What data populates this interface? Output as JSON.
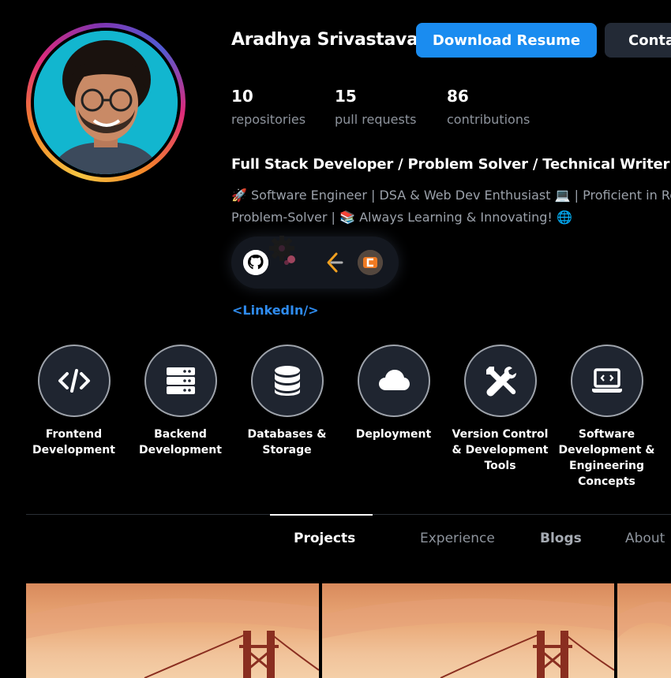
{
  "profile": {
    "name": "Aradhya Srivastava",
    "download_resume": "Download Resume",
    "contact": "Conta",
    "headline": "Full Stack Developer / Problem Solver / Technical Writer",
    "bio_line1": "Software Engineer | DSA & Web Dev Enthusiast",
    "bio_line1_tail": "| Proficient in Rea",
    "bio_line2": "Problem-Solver |",
    "bio_line2_tail": "Always Learning & Innovating!",
    "linkedin": "<LinkedIn/>"
  },
  "stats": [
    {
      "value": "10",
      "label": "repositories"
    },
    {
      "value": "15",
      "label": "pull requests"
    },
    {
      "value": "86",
      "label": "contributions"
    }
  ],
  "social": [
    {
      "icon": "github-icon"
    },
    {
      "icon": "gear-icon"
    },
    {
      "icon": "leetcode-icon"
    },
    {
      "icon": "codechef-icon"
    }
  ],
  "skills": [
    {
      "label": "Frontend Development",
      "icon": "code-icon"
    },
    {
      "label": "Backend Development",
      "icon": "server-icon"
    },
    {
      "label": "Databases & Storage",
      "icon": "database-icon"
    },
    {
      "label": "Deployment",
      "icon": "cloud-icon"
    },
    {
      "label": "Version Control & Development Tools",
      "icon": "tools-icon"
    },
    {
      "label": "Software Development & Engineering Concepts",
      "icon": "laptop-code-icon"
    }
  ],
  "tabs": [
    {
      "label": "Projects",
      "active": true
    },
    {
      "label": "Experience",
      "active": false
    },
    {
      "label": "Blogs",
      "active": false
    },
    {
      "label": "About",
      "active": false
    }
  ],
  "colors": {
    "accent": "#1a8cf0",
    "link": "#2f8cf0",
    "background": "#000000",
    "muted_text": "#8d939c"
  }
}
